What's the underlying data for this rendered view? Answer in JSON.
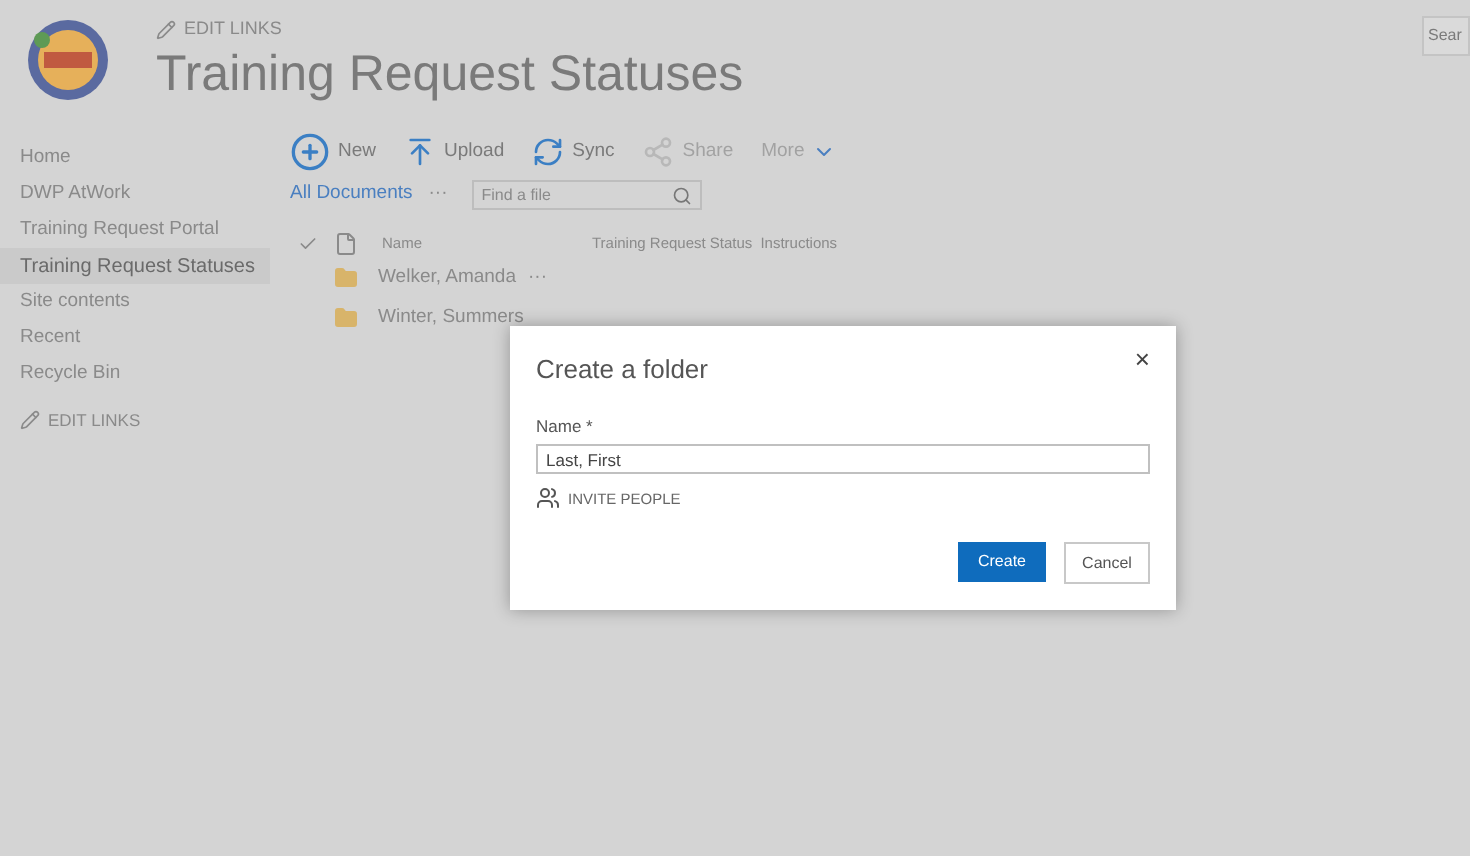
{
  "header": {
    "edit_links": "EDIT LINKS",
    "title": "Training Request Statuses",
    "search": {
      "placeholder": "Sear"
    }
  },
  "sidebar": {
    "items": [
      {
        "label": "Home",
        "selected": false
      },
      {
        "label": "DWP AtWork",
        "selected": false
      },
      {
        "label": "Training Request Portal",
        "selected": false
      },
      {
        "label": "Training Request Statuses",
        "selected": true
      },
      {
        "label": "Site contents",
        "selected": false
      },
      {
        "label": "Recent",
        "selected": false
      },
      {
        "label": "Recycle Bin",
        "selected": false
      }
    ],
    "edit_links": "EDIT LINKS"
  },
  "toolbar": [
    {
      "kind": "new",
      "label": "New",
      "disabled": false
    },
    {
      "kind": "upload",
      "label": "Upload",
      "disabled": false
    },
    {
      "kind": "sync",
      "label": "Sync",
      "disabled": false
    },
    {
      "kind": "share",
      "label": "Share",
      "disabled": true
    },
    {
      "kind": "more",
      "label": "More",
      "disabled": true
    }
  ],
  "view": {
    "label": "All Documents",
    "more": "···",
    "find": {
      "placeholder": "Find a file"
    }
  },
  "table": {
    "columns": [
      "Name",
      "Training Request Status",
      "Instructions"
    ],
    "rows": [
      {
        "name": "Welker, Amanda",
        "more": "···"
      },
      {
        "name": "Winter, Summers"
      }
    ]
  },
  "dialog": {
    "title": "Create a folder",
    "close": "×",
    "field_label": "Name *",
    "field_value": "Last, First",
    "invite": "INVITE PEOPLE",
    "buttons": [
      {
        "kind": "primary",
        "label": "Create"
      },
      {
        "kind": "secondary",
        "label": "Cancel"
      }
    ]
  }
}
